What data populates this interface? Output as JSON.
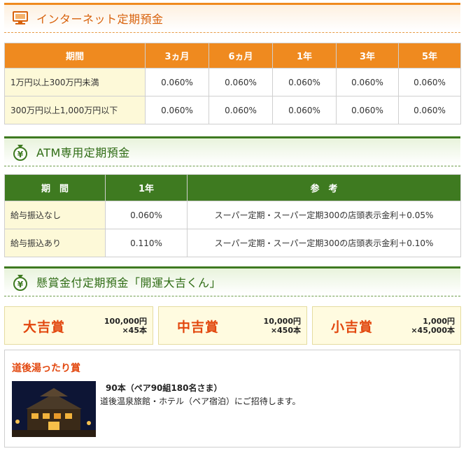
{
  "internet": {
    "title": "インターネット定期預金",
    "columns": [
      "期間",
      "3ヵ月",
      "6ヵ月",
      "1年",
      "3年",
      "5年"
    ],
    "rows": [
      {
        "label": "1万円以上300万円未満",
        "values": [
          "0.060%",
          "0.060%",
          "0.060%",
          "0.060%",
          "0.060%"
        ]
      },
      {
        "label": "300万円以上1,000万円以下",
        "values": [
          "0.060%",
          "0.060%",
          "0.060%",
          "0.060%",
          "0.060%"
        ]
      }
    ]
  },
  "atm": {
    "title": "ATM専用定期預金",
    "columns": [
      "期　間",
      "1年",
      "参　考"
    ],
    "rows": [
      {
        "label": "給与振込なし",
        "rate": "0.060%",
        "note": "スーパー定期・スーパー定期300の店頭表示金利＋0.05%"
      },
      {
        "label": "給与振込あり",
        "rate": "0.110%",
        "note": "スーパー定期・スーパー定期300の店頭表示金利＋0.10%"
      }
    ]
  },
  "prize": {
    "title": "懸賞金付定期預金「開運大吉くん」",
    "items": [
      {
        "name": "大吉賞",
        "amount": "100,000円",
        "count": "×45本"
      },
      {
        "name": "中吉賞",
        "amount": "10,000円",
        "count": "×450本"
      },
      {
        "name": "小吉賞",
        "amount": "1,000円",
        "count": "×45,000本"
      }
    ]
  },
  "dogo": {
    "title": "道後湯ったり賞",
    "line1": "90本（ペア90組180名さま）",
    "line2": "道後温泉旅館・ホテル（ペア宿泊）にご招待します。"
  },
  "colors": {
    "orange": "#ef8a1f",
    "green": "#3e7a20",
    "prize_red": "#e2470e",
    "row_cream": "#fdf9d8"
  },
  "icons": {
    "internet": "computer-monitor-icon",
    "atm": "yen-money-bag-icon",
    "prize": "yen-money-bag-icon"
  }
}
